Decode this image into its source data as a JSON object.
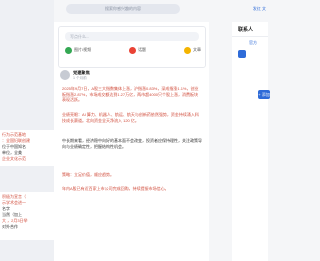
{
  "header": {
    "search_placeholder": "搜索你感兴趣的内容",
    "top_link": "发红 文"
  },
  "left_panel": {
    "lines_red": [
      "行为示范基地",
      "：全国妇联创建",
      "企业文化示范",
      "积极为宣言（",
      "示学术会进一",
      "大 ，2月3日举"
    ],
    "lines_dark": [
      "位于中国知名",
      "单位，全美",
      "名字",
      "当然（加上",
      "对外合作"
    ]
  },
  "composer": {
    "placeholder": "写点什么...",
    "tools": [
      {
        "label": "图片/视频",
        "icon": "image-icon",
        "color": "#34a853"
      },
      {
        "label": "话题",
        "icon": "hashtag-icon",
        "color": "#ea4335"
      },
      {
        "label": "文章",
        "icon": "article-icon",
        "color": "#f4b400"
      }
    ]
  },
  "post": {
    "author": "党建聚焦",
    "time": "1 个月前",
    "paragraphs": [
      "2025年9月7日，A股三大指数集体上涨，沪指涨0.83%，深成指涨1.1%，创业板指涨2.87%，市场成交额达到1.27万亿，两市超4000只个股上涨，消费板块表现活跃。",
      "业绩亮眼：AI 算力、机器人、航运、航天与创新药依然强势，资金持续涌入科技成长赛道。北向资金全天净流入 120 亿。",
      "中长期来看，经济稳中向好的基本面不会改变，投资者应保持理性，关注政策导向与业绩确定性，把握结构性机会。",
      "策略：立足价值，顺应趋势。",
      "年内A股已有近百家上市公司完成回购，持续提振市场信心。"
    ]
  },
  "right_panel": {
    "title": "联系人",
    "tab": "官方",
    "button": "+ 添加"
  }
}
